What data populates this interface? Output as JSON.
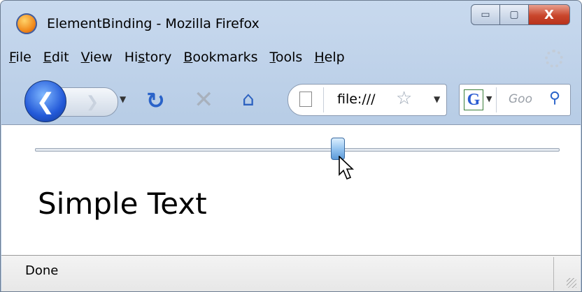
{
  "window": {
    "title": "ElementBinding - Mozilla Firefox"
  },
  "window_buttons": {
    "minimize": "▭",
    "maximize": "▢",
    "close": "X"
  },
  "menu": [
    {
      "label": "File",
      "accel": "F",
      "rest": "ile"
    },
    {
      "label": "Edit",
      "accel": "E",
      "rest": "dit"
    },
    {
      "label": "View",
      "accel": "V",
      "rest": "iew"
    },
    {
      "label": "History",
      "pre": "Hi",
      "accel": "s",
      "rest": "tory"
    },
    {
      "label": "Bookmarks",
      "accel": "B",
      "rest": "ookmarks"
    },
    {
      "label": "Tools",
      "accel": "T",
      "rest": "ools"
    },
    {
      "label": "Help",
      "accel": "H",
      "rest": "elp"
    }
  ],
  "navbar": {
    "url": "file:///",
    "search_placeholder": "Goo",
    "search_engine_icon": "G"
  },
  "icons": {
    "back": "back-arrow-icon",
    "forward": "forward-arrow-icon",
    "reload": "reload-icon",
    "stop": "stop-icon",
    "home": "home-icon",
    "bookmark_star": "star-icon",
    "search": "magnifier-icon"
  },
  "content": {
    "slider_value_fraction": 0.58,
    "text": "Simple Text"
  },
  "status": {
    "text": "Done"
  },
  "colors": {
    "accent": "#2a63c9",
    "title_bar": "#c8d9ee",
    "close": "#c9462c"
  }
}
